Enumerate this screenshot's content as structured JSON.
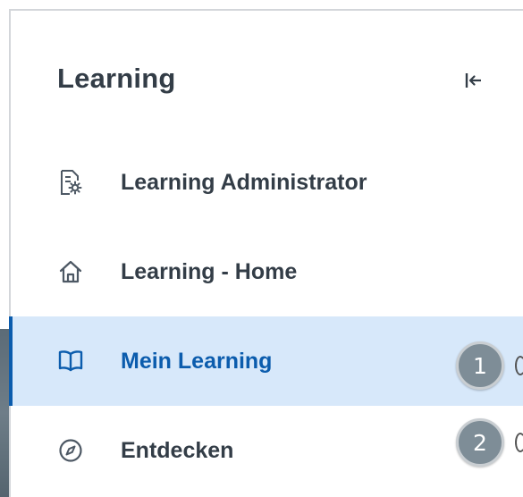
{
  "panel": {
    "title": "Learning",
    "collapse_icon": "collapse-left-icon"
  },
  "nav": {
    "items": [
      {
        "label": "Learning Administrator",
        "icon": "document-settings-icon",
        "active": false
      },
      {
        "label": "Learning - Home",
        "icon": "home-icon",
        "active": false
      },
      {
        "label": "Mein Learning",
        "icon": "book-open-icon",
        "active": true
      },
      {
        "label": "Entdecken",
        "icon": "compass-icon",
        "active": false
      }
    ]
  },
  "callouts": [
    {
      "number": "1"
    },
    {
      "number": "2"
    }
  ],
  "colors": {
    "active_background": "#d7e8fa",
    "active_accent": "#0b5cad",
    "text": "#333d47",
    "badge": "#7e8d97"
  }
}
